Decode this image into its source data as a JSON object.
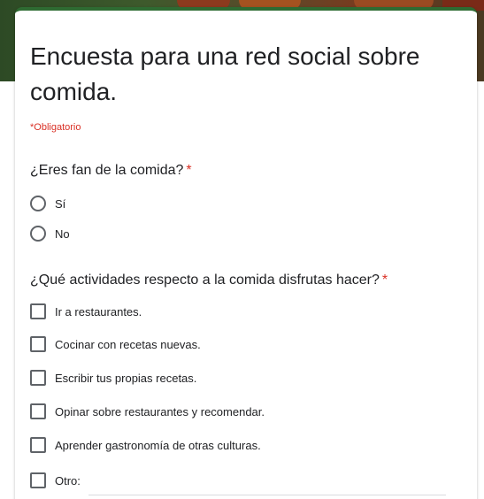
{
  "form": {
    "title": "Encuesta para una red social sobre comida.",
    "required_note": "*Obligatorio"
  },
  "questions": [
    {
      "text": "¿Eres fan de la comida?",
      "required_mark": "*",
      "type": "radio",
      "options": [
        "Sí",
        "No"
      ]
    },
    {
      "text": "¿Qué actividades respecto a la comida disfrutas hacer?",
      "required_mark": "*",
      "type": "checkbox",
      "options": [
        "Ir a restaurantes.",
        "Cocinar con recetas nuevas.",
        "Escribir tus propias recetas.",
        "Opinar sobre restaurantes y recomendar.",
        "Aprender gastronomía de otras culturas.",
        "Otro:"
      ]
    }
  ],
  "colors": {
    "accent": "#2e6b32",
    "required": "#d93025",
    "text": "#202124"
  }
}
